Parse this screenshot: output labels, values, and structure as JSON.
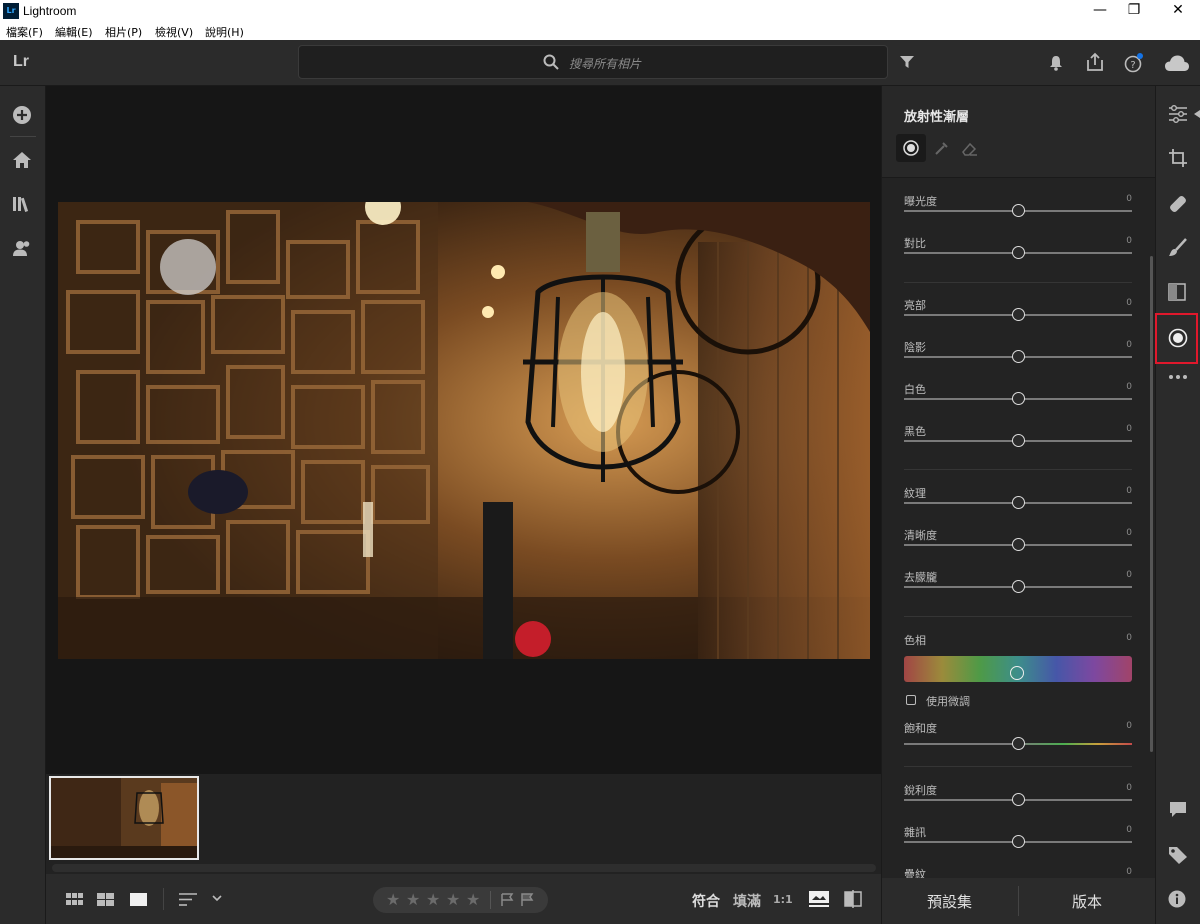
{
  "window": {
    "app_name": "Lightroom",
    "logo_text": "Lr",
    "minimize": "—",
    "maximize": "❐",
    "close": "✕"
  },
  "menu": {
    "items": [
      "檔案(F)",
      "編輯(E)",
      "相片(P)",
      "檢視(V)",
      "說明(H)"
    ]
  },
  "topbar": {
    "brand": "Lr",
    "search_placeholder": "搜尋所有相片"
  },
  "panel": {
    "title": "放射性漸層",
    "sliders": [
      {
        "label": "曝光度",
        "value": "0"
      },
      {
        "label": "對比",
        "value": "0"
      },
      {
        "label": "亮部",
        "value": "0"
      },
      {
        "label": "陰影",
        "value": "0"
      },
      {
        "label": "白色",
        "value": "0"
      },
      {
        "label": "黑色",
        "value": "0"
      },
      {
        "label": "紋理",
        "value": "0"
      },
      {
        "label": "清晰度",
        "value": "0"
      },
      {
        "label": "去朦朧",
        "value": "0"
      },
      {
        "label": "色相",
        "value": "0"
      },
      {
        "label": "飽和度",
        "value": "0"
      },
      {
        "label": "銳利度",
        "value": "0"
      },
      {
        "label": "雜訊",
        "value": "0"
      },
      {
        "label": "疊紋",
        "value": "0"
      }
    ],
    "use_fine_adjust": "使用微調",
    "presets_label": "預設集",
    "versions_label": "版本"
  },
  "bottombar": {
    "fit_label": "符合",
    "fill_label": "填滿",
    "one_to_one": "1:1",
    "stars": [
      "★",
      "★",
      "★",
      "★",
      "★"
    ]
  },
  "colors": {
    "accent_blue": "#1473e6",
    "highlight_red": "#e0182c"
  }
}
